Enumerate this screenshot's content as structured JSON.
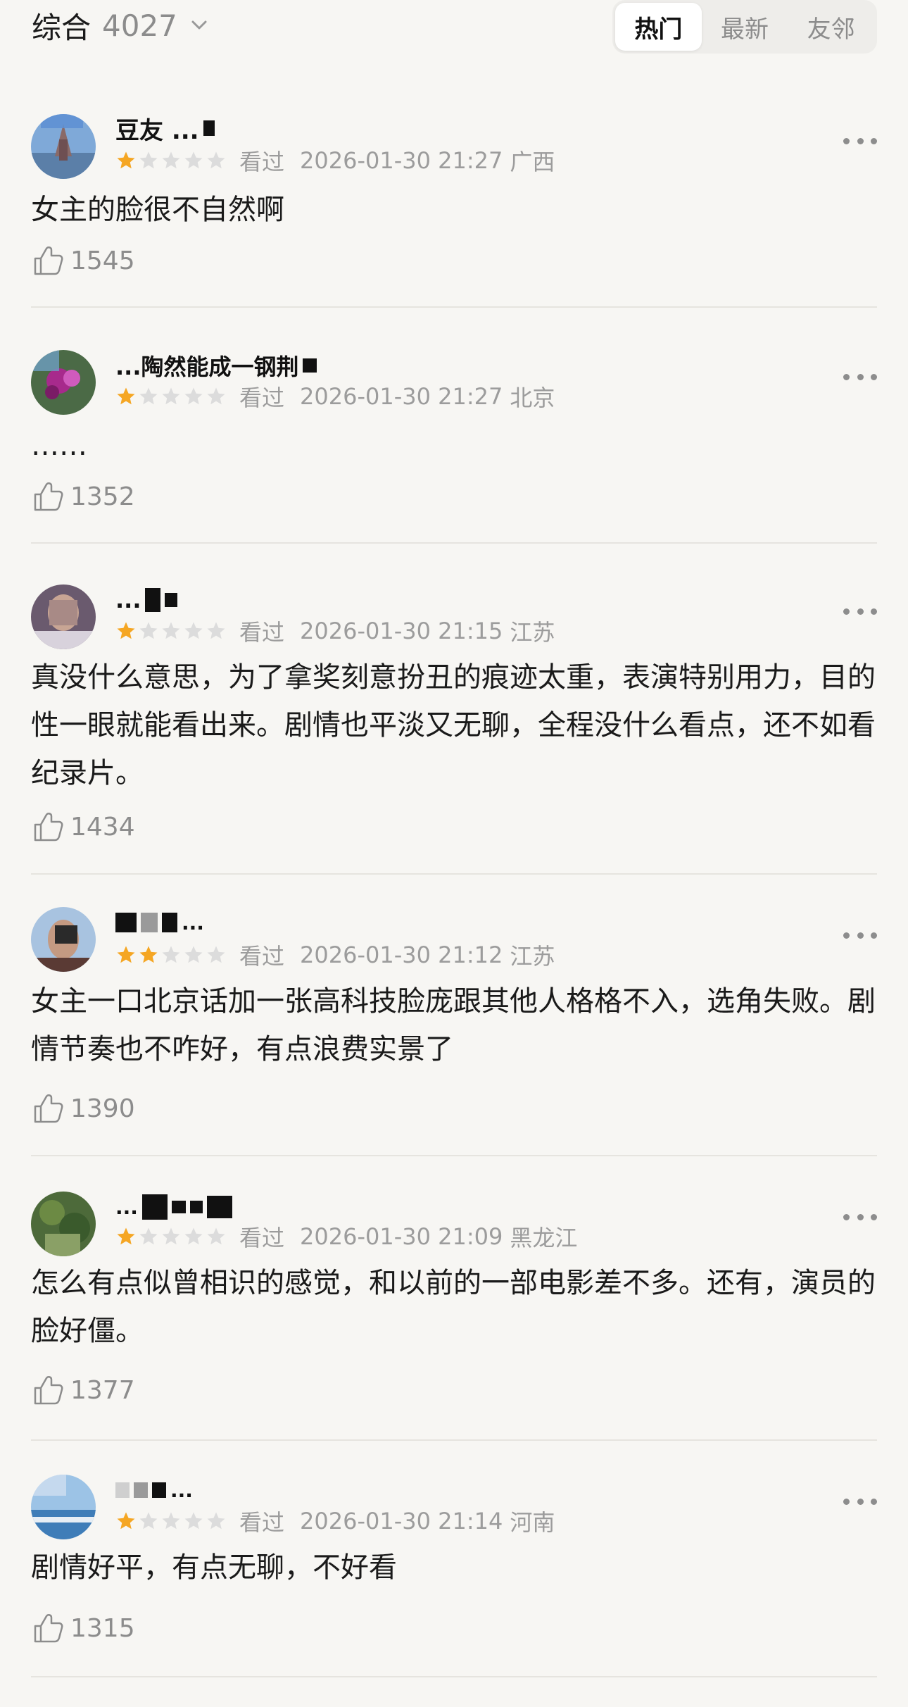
{
  "header": {
    "filter_label": "综合",
    "filter_count": "4027",
    "tabs": [
      {
        "label": "热门",
        "active": true
      },
      {
        "label": "最新",
        "active": false
      },
      {
        "label": "友邻",
        "active": false
      }
    ]
  },
  "colors": {
    "star_filled": "#f5a623",
    "star_empty": "#dcdcdc",
    "background": "#f7f6f3"
  },
  "reviews": [
    {
      "username": "豆友 ...",
      "rating": 1,
      "status": "看过",
      "time": "2026-01-30 21:27",
      "location": "广西",
      "content": "女主的脸很不自然啊",
      "likes": "1545"
    },
    {
      "username": "...陶然能成一钢荆",
      "rating": 1,
      "status": "看过",
      "time": "2026-01-30 21:27",
      "location": "北京",
      "content": "……",
      "likes": "1352"
    },
    {
      "username": "...",
      "rating": 1,
      "status": "看过",
      "time": "2026-01-30 21:15",
      "location": "江苏",
      "content": "真没什么意思，为了拿奖刻意扮丑的痕迹太重，表演特别用力，目的性一眼就能看出来。剧情也平淡又无聊，全程没什么看点，还不如看纪录片。",
      "likes": "1434"
    },
    {
      "username": "...",
      "rating": 2,
      "status": "看过",
      "time": "2026-01-30 21:12",
      "location": "江苏",
      "content": "女主一口北京话加一张高科技脸庞跟其他人格格不入，选角失败。剧情节奏也不咋好，有点浪费实景了",
      "likes": "1390"
    },
    {
      "username": "...",
      "rating": 1,
      "status": "看过",
      "time": "2026-01-30 21:09",
      "location": "黑龙江",
      "content": "怎么有点似曾相识的感觉，和以前的一部电影差不多。还有，演员的脸好僵。",
      "likes": "1377"
    },
    {
      "username": "...",
      "rating": 1,
      "status": "看过",
      "time": "2026-01-30 21:14",
      "location": "河南",
      "content": "剧情好平，有点无聊，不好看",
      "likes": "1315"
    }
  ]
}
